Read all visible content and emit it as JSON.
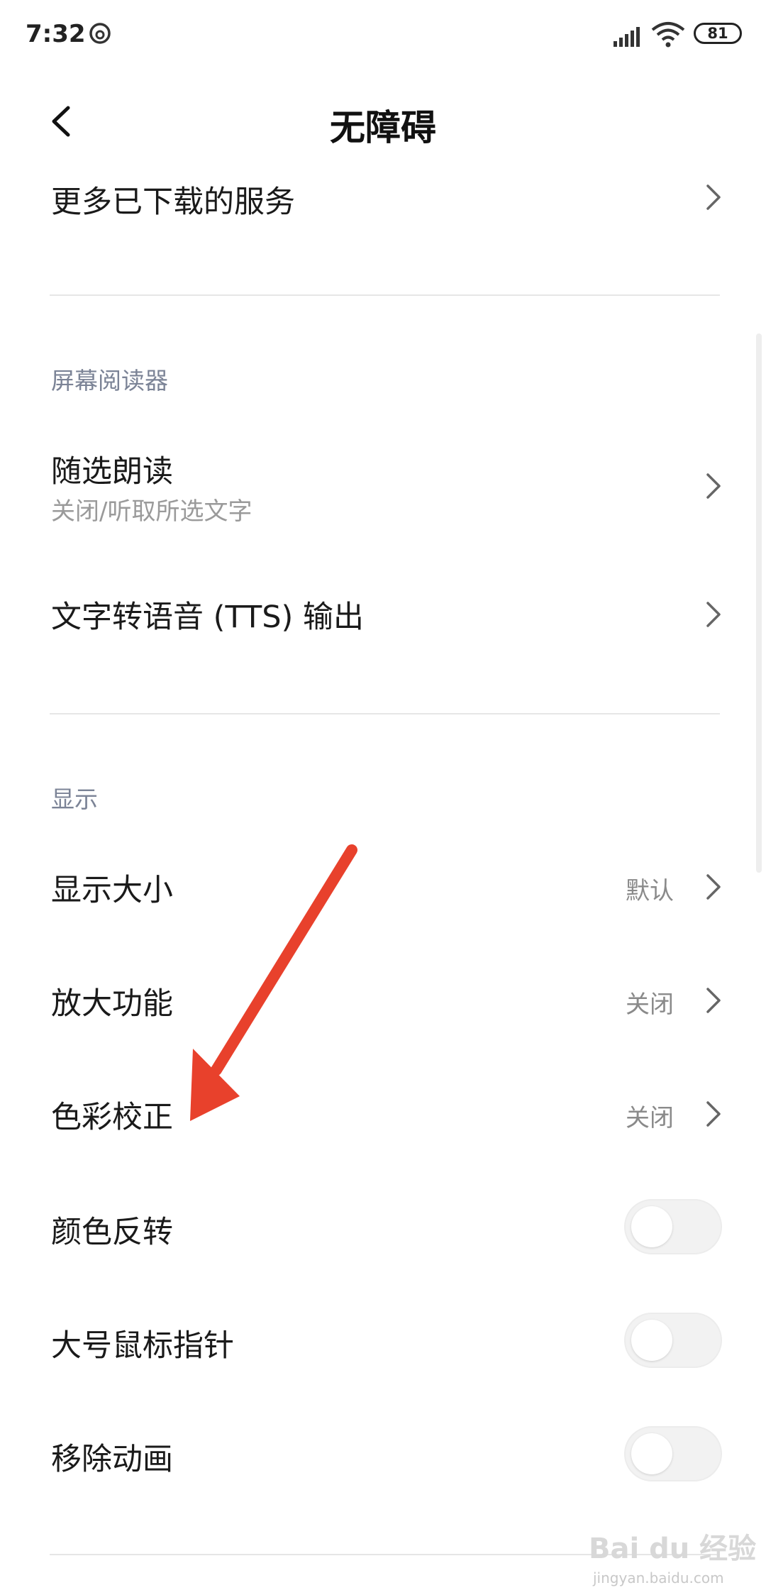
{
  "status_bar": {
    "time": "7:32",
    "battery": "81"
  },
  "header": {
    "title": "无障碍"
  },
  "items_top": {
    "more_services": "更多已下载的服务"
  },
  "screen_reader": {
    "section_title": "屏幕阅读器",
    "select_to_speak": {
      "label": "随选朗读",
      "sub": "关闭/听取所选文字"
    },
    "tts_output": {
      "label": "文字转语音 (TTS) 输出"
    }
  },
  "display": {
    "section_title": "显示",
    "display_size": {
      "label": "显示大小",
      "value": "默认"
    },
    "magnification": {
      "label": "放大功能",
      "value": "关闭"
    },
    "color_correction": {
      "label": "色彩校正",
      "value": "关闭"
    },
    "color_inversion": {
      "label": "颜色反转",
      "enabled": false
    },
    "large_pointer": {
      "label": "大号鼠标指针",
      "enabled": false
    },
    "remove_animations": {
      "label": "移除动画",
      "enabled": false
    }
  },
  "annotation": {
    "arrow_color": "#e8412c"
  },
  "watermark": {
    "logo": "Bai du 经验",
    "url": "jingyan.baidu.com"
  }
}
